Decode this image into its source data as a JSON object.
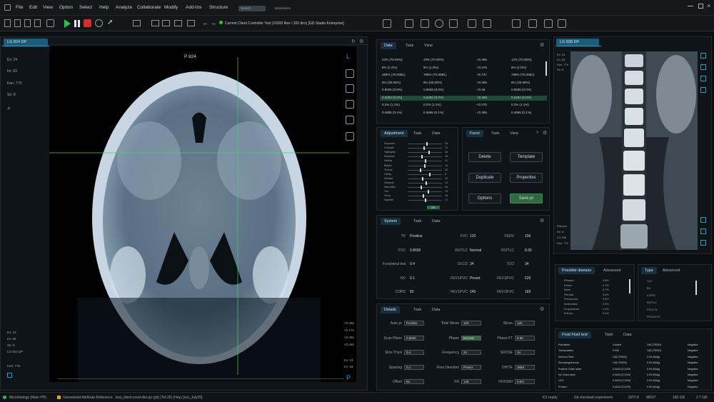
{
  "menu": {
    "items": [
      "File",
      "Edit",
      "View",
      "Option",
      "Select",
      "Help",
      "Analyze",
      "Collaborate",
      "Modify",
      "Add-Ins",
      "Structure"
    ],
    "search_placeholder": "Search",
    "extensions": "Extensions"
  },
  "toolbar": {
    "path": "Current Client Controller Test (10293 files \\ 302 dirs) [GD Studio Enterprise]"
  },
  "left_panel": {
    "tab": "LG 824 DP",
    "slice_label": "P 824",
    "side_top": "L",
    "side_bottom": "P",
    "info": [
      "Ex: 24",
      "Im: 83",
      "Kan: 779",
      "Se: 8"
    ],
    "bottom_info": [
      "Ex: 24",
      "Im: 83",
      "Se: 8",
      "LG 824 DP",
      "Kan: 779"
    ],
    "right_vals": [
      "<0.285",
      "<0.275",
      "<0.265",
      "<0.255"
    ],
    "bottom_right": [
      "Ex: 24",
      "Im: 83"
    ]
  },
  "data_panel": {
    "tabs": [
      "Data",
      "Task",
      "View"
    ],
    "rows": [
      [
        "23% (70.00%)",
        "23% (70.00%)",
        "<0.285",
        "12% (70.00%)"
      ],
      [
        "8% (1.0%)",
        "8% (1.0%)",
        "<0.275",
        "8% (1.0%)"
      ],
      [
        "258% (70.00BL)",
        "798% (70.00BL)",
        "<0.747",
        "798% (70.00BL)"
      ],
      [
        "8% (30.00%)",
        "8% (30.00%)",
        "<0.285",
        "8% (30.00%)"
      ],
      [
        "0.8835 (0.0%)",
        "0.8835 (0.0%)",
        "<0.26",
        "0.8835 (0.0%)"
      ],
      [
        "0.6282 (0.0%)",
        "0.6282 (0.0%)",
        "<0.268",
        "0.6282 (0.0%)"
      ],
      [
        "0.2% (1.1%)",
        "0.2% (1.1%)",
        "<0.275",
        "0.2% (1.1%)"
      ],
      [
        "0.4685 (0.1%)",
        "0.4685 (0.1%)",
        "<0.285",
        "0.4685 (0.1%)"
      ]
    ]
  },
  "adjustment": {
    "tabs": [
      "Adjustment",
      "Task",
      "Data"
    ],
    "sliders": [
      {
        "name": "Exposure",
        "v": "18",
        "pos": 0.55
      },
      {
        "name": "Contrast",
        "v": "14",
        "pos": 0.45
      },
      {
        "name": "Highlights",
        "v": "16",
        "pos": 0.6
      },
      {
        "name": "Shadows",
        "v": "18",
        "pos": 0.4
      },
      {
        "name": "Whites",
        "v": "12",
        "pos": 0.5
      },
      {
        "name": "Blacks",
        "v": "15",
        "pos": 0.48
      },
      {
        "name": "Texture",
        "v": "10",
        "pos": 0.35
      },
      {
        "name": "Clarity",
        "v": "8",
        "pos": 0.62
      },
      {
        "name": "Dehaze",
        "v": "14",
        "pos": 0.42
      },
      {
        "name": "Vibrance",
        "v": "12",
        "pos": 0.52
      },
      {
        "name": "Saturation",
        "v": "16",
        "pos": 0.38
      },
      {
        "name": "Tint",
        "v": "10",
        "pos": 0.58
      },
      {
        "name": "Temp",
        "v": "18",
        "pos": 0.44
      },
      {
        "name": "Vignette",
        "v": "12",
        "pos": 0.5
      }
    ],
    "ok": "OK"
  },
  "function": {
    "tabs": [
      "Funct",
      "Task",
      "View"
    ],
    "buttons": [
      "Delete",
      "Template",
      "Duplicate",
      "Properties",
      "Options",
      "Save pr"
    ]
  },
  "system": {
    "tabs": [
      "System",
      "Task",
      "Data"
    ],
    "rows": [
      [
        "TV",
        "Positive",
        "FVC",
        "120",
        "FEDV",
        "156"
      ],
      [
        "FVC",
        "0.8600",
        "RV/TLC",
        "Normal",
        "RV/TLC",
        "8.95"
      ],
      [
        "Functional test",
        "0.4",
        "DLCO",
        "34",
        "TCO",
        "34"
      ],
      [
        "RV",
        "0.1",
        "FEV1/FVC",
        "Preset",
        "FEV1/FVC",
        "529"
      ],
      [
        "COPD",
        "82",
        "FEV1/FVC",
        "145",
        "FEV1/FVC",
        "169"
      ]
    ]
  },
  "details": {
    "tabs": [
      "Details",
      "Task",
      "Data"
    ],
    "fields": [
      [
        "Auto pr",
        "Positive",
        "Total Slices",
        "120",
        "Slices",
        "120"
      ],
      [
        "Scan Plane",
        "0.8600",
        "Phase",
        "Normal",
        "Phase FT",
        "8.95"
      ],
      [
        "Slice Thick",
        "0.4",
        "Frequency",
        "24",
        "SUOSE",
        "34"
      ],
      [
        "Spacing",
        "0.1",
        "Flow Direction",
        "Preset",
        "DHITE",
        "3893"
      ],
      [
        "Offset",
        "82",
        "FR",
        "145",
        "HOOSRI",
        "0.0/2"
      ]
    ]
  },
  "right_top": {
    "tab": "LG 838 DP",
    "info": [
      "Ex: 24",
      "Im: 83",
      "Kan: 779",
      "Se: 8"
    ],
    "bottom_info": [
      "Effusion",
      "Se: 8",
      "LG 838",
      "Kan: 779"
    ]
  },
  "possible": {
    "tabs": [
      "Possible disease",
      "Advanced"
    ],
    "items": [
      [
        "Effusion",
        "0.8%"
      ],
      [
        "Rubric",
        "0.7%"
      ],
      [
        "Mass",
        "0.7%"
      ],
      [
        "Fibrosis",
        "0.6%"
      ],
      [
        "Pneumonia",
        "0.6%"
      ],
      [
        "Atelectasis",
        "0.5%"
      ],
      [
        "Emphysema",
        "0.4%"
      ],
      [
        "Edema",
        "0.4%"
      ]
    ]
  },
  "type_panel": {
    "tabs": [
      "Type",
      "Advanced"
    ],
    "items": [
      "TLC",
      "RV",
      "COPD",
      "RV/TLC",
      "FEV1 %",
      "FEV1/FVC"
    ]
  },
  "fluid": {
    "tabs": [
      "Fluid Fluid test",
      "Task",
      "Data"
    ],
    "rows": [
      [
        "Exudation",
        "Guided",
        "148 (70000)",
        "Negative"
      ],
      [
        "Transudation",
        "0.000",
        "148 (70000)",
        "Negative"
      ],
      [
        "Venous Fluid",
        "148 (70000)",
        "0.09 (Bldg)",
        "Negative"
      ],
      [
        "Serosanguineous",
        "148 (70000)",
        "0.09 (Bldg)",
        "Negative"
      ],
      [
        "Positive Gram stain",
        "0.0043 (0.10%)",
        "0.09 (Bldg)",
        "Negative"
      ],
      [
        "No Gram stain",
        "0.0043 (0.10%)",
        "0.09 (Bldg)",
        "Negative"
      ],
      [
        "LDH",
        "0.0043 (0.10%)",
        "0.09 (Bldg)",
        "Negative"
      ],
      [
        "Protein",
        "0.0043 (0.10%)",
        "0.09 (Bldg)",
        "Negative"
      ]
    ]
  },
  "status": {
    "items": [
      "Microbiology (Main PH)",
      "Unresolved Attribute Reference",
      "test_client:controller.py (git) (Tst-25) (Hey) [run_July25]",
      "KX ready",
      "Git checkout experiment",
      "GHT-8",
      "MR07",
      "180 GB",
      "2.7 GB"
    ]
  },
  "colors": {
    "accent": "#1fa3c9",
    "green_line": "#3cd56a",
    "run": "#2dc23a",
    "stop": "#d92b2b"
  }
}
